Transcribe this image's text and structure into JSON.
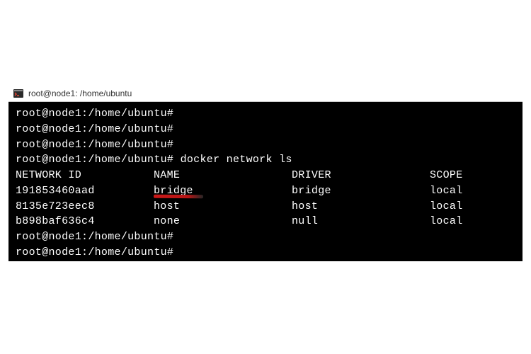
{
  "title_bar": {
    "icon_name": "terminal-icon",
    "title": "root@node1: /home/ubuntu"
  },
  "terminal": {
    "prompt": "root@node1:/home/ubuntu#",
    "command": "docker network ls",
    "headers": {
      "id": "NETWORK ID",
      "name": "NAME",
      "driver": "DRIVER",
      "scope": "SCOPE"
    },
    "rows": [
      {
        "id": "191853460aad",
        "name": "bridge",
        "driver": "bridge",
        "scope": "local"
      },
      {
        "id": "8135e723eec8",
        "name": "host",
        "driver": "host",
        "scope": "local"
      },
      {
        "id": "b898baf636c4",
        "name": "none",
        "driver": "null",
        "scope": "local"
      }
    ]
  }
}
